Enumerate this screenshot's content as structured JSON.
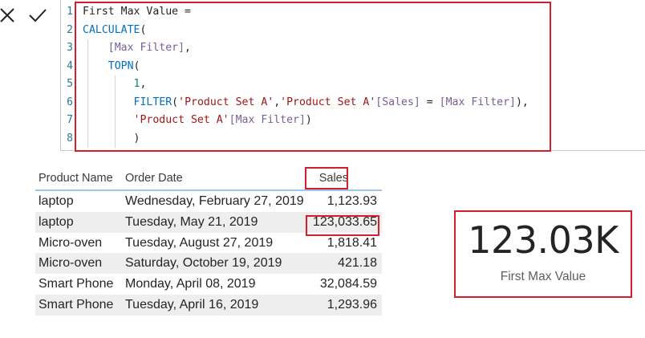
{
  "formula_bar": {
    "cancel_icon": "close-icon",
    "commit_icon": "checkmark-icon",
    "line_numbers": [
      "1",
      "2",
      "3",
      "4",
      "5",
      "6",
      "7",
      "8"
    ],
    "lines": [
      {
        "tokens": [
          {
            "t": "plain",
            "v": "First Max Value ="
          }
        ]
      },
      {
        "tokens": [
          {
            "t": "fn",
            "v": "CALCULATE"
          },
          {
            "t": "punct",
            "v": "("
          }
        ]
      },
      {
        "tokens": [
          {
            "t": "plain",
            "v": "    "
          },
          {
            "t": "meas",
            "v": "[Max Filter]"
          },
          {
            "t": "punct",
            "v": ","
          }
        ]
      },
      {
        "tokens": [
          {
            "t": "plain",
            "v": "    "
          },
          {
            "t": "fn",
            "v": "TOPN"
          },
          {
            "t": "punct",
            "v": "("
          }
        ]
      },
      {
        "tokens": [
          {
            "t": "plain",
            "v": "        "
          },
          {
            "t": "num",
            "v": "1"
          },
          {
            "t": "punct",
            "v": ","
          }
        ]
      },
      {
        "tokens": [
          {
            "t": "plain",
            "v": "        "
          },
          {
            "t": "fn",
            "v": "FILTER"
          },
          {
            "t": "punct",
            "v": "("
          },
          {
            "t": "str",
            "v": "'Product Set A'"
          },
          {
            "t": "punct",
            "v": ","
          },
          {
            "t": "str",
            "v": "'Product Set A'"
          },
          {
            "t": "meas",
            "v": "[Sales]"
          },
          {
            "t": "punct",
            "v": " = "
          },
          {
            "t": "meas",
            "v": "[Max Filter]"
          },
          {
            "t": "punct",
            "v": "),"
          }
        ]
      },
      {
        "tokens": [
          {
            "t": "plain",
            "v": "        "
          },
          {
            "t": "str",
            "v": "'Product Set A'"
          },
          {
            "t": "meas",
            "v": "[Max Filter]"
          },
          {
            "t": "punct",
            "v": ")"
          }
        ]
      },
      {
        "tokens": [
          {
            "t": "plain",
            "v": "        "
          },
          {
            "t": "punct",
            "v": ")"
          }
        ]
      }
    ],
    "colors": {
      "highlight_frame": "#d21f2d"
    }
  },
  "table": {
    "headers": {
      "product_name": "Product Name",
      "order_date": "Order Date",
      "sales": "Sales"
    },
    "rows": [
      {
        "product_name": "laptop",
        "order_date": "Wednesday, February 27, 2019",
        "sales": "1,123.93"
      },
      {
        "product_name": "laptop",
        "order_date": "Tuesday, May 21, 2019",
        "sales": "123,033.65"
      },
      {
        "product_name": "Micro-oven",
        "order_date": "Tuesday, August 27, 2019",
        "sales": "1,818.41"
      },
      {
        "product_name": "Micro-oven",
        "order_date": "Saturday, October 19, 2019",
        "sales": "421.18"
      },
      {
        "product_name": "Smart Phone",
        "order_date": "Monday, April 08, 2019",
        "sales": "32,084.59"
      },
      {
        "product_name": "Smart Phone",
        "order_date": "Tuesday, April 16, 2019",
        "sales": "1,293.96"
      }
    ],
    "highlighted_row": 1
  },
  "card": {
    "value": "123.03K",
    "label": "First Max Value"
  }
}
